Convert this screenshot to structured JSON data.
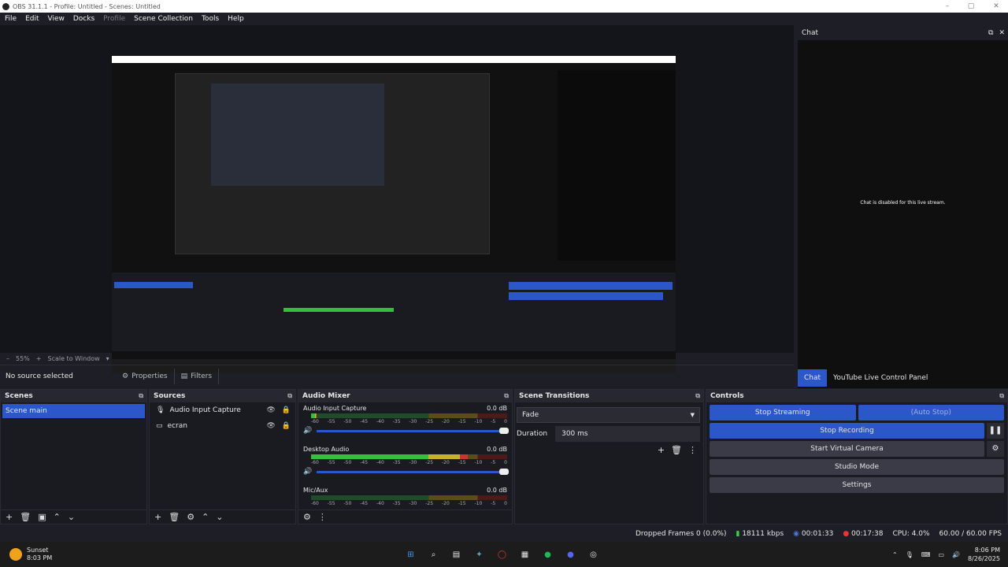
{
  "window": {
    "title": "OBS 31.1.1 - Profile: Untitled - Scenes: Untitled"
  },
  "menu": [
    "File",
    "Edit",
    "View",
    "Docks",
    "Profile",
    "Scene Collection",
    "Tools",
    "Help"
  ],
  "preview": {
    "zoom": "55%",
    "scale_mode": "Scale to Window"
  },
  "context": {
    "no_source": "No source selected",
    "properties": "Properties",
    "filters": "Filters"
  },
  "chat": {
    "title": "Chat",
    "message": "Chat is disabled for this live stream.",
    "tabs": [
      "Chat",
      "YouTube Live Control Panel"
    ]
  },
  "scenes": {
    "title": "Scenes",
    "items": [
      "Scene main"
    ]
  },
  "sources": {
    "title": "Sources",
    "items": [
      "Audio Input Capture",
      "ecran"
    ]
  },
  "mixer": {
    "title": "Audio Mixer",
    "channels": [
      {
        "name": "Audio Input Capture",
        "db": "0.0 dB",
        "level": 0.03
      },
      {
        "name": "Desktop Audio",
        "db": "0.0 dB",
        "level": 0.8
      },
      {
        "name": "Mic/Aux",
        "db": "0.0 dB",
        "level": 0.0
      }
    ],
    "ticks": [
      "-60",
      "-55",
      "-50",
      "-45",
      "-40",
      "-35",
      "-30",
      "-25",
      "-20",
      "-15",
      "-10",
      "-5",
      "0"
    ]
  },
  "transitions": {
    "title": "Scene Transitions",
    "selected": "Fade",
    "duration_label": "Duration",
    "duration": "300 ms"
  },
  "controls": {
    "title": "Controls",
    "stop_streaming": "Stop Streaming",
    "auto_stop": "(Auto Stop)",
    "stop_recording": "Stop Recording",
    "virtual_camera": "Start Virtual Camera",
    "studio_mode": "Studio Mode",
    "settings": "Settings"
  },
  "status": {
    "dropped": "Dropped Frames 0 (0.0%)",
    "bitrate": "18111 kbps",
    "stream_time": "00:01:33",
    "rec_time": "00:17:38",
    "cpu": "CPU: 4.0%",
    "fps": "60.00 / 60.00 FPS"
  },
  "taskbar": {
    "weather_title": "Sunset",
    "weather_time": "8:03 PM",
    "time": "8:06 PM",
    "date": "8/26/2025"
  }
}
